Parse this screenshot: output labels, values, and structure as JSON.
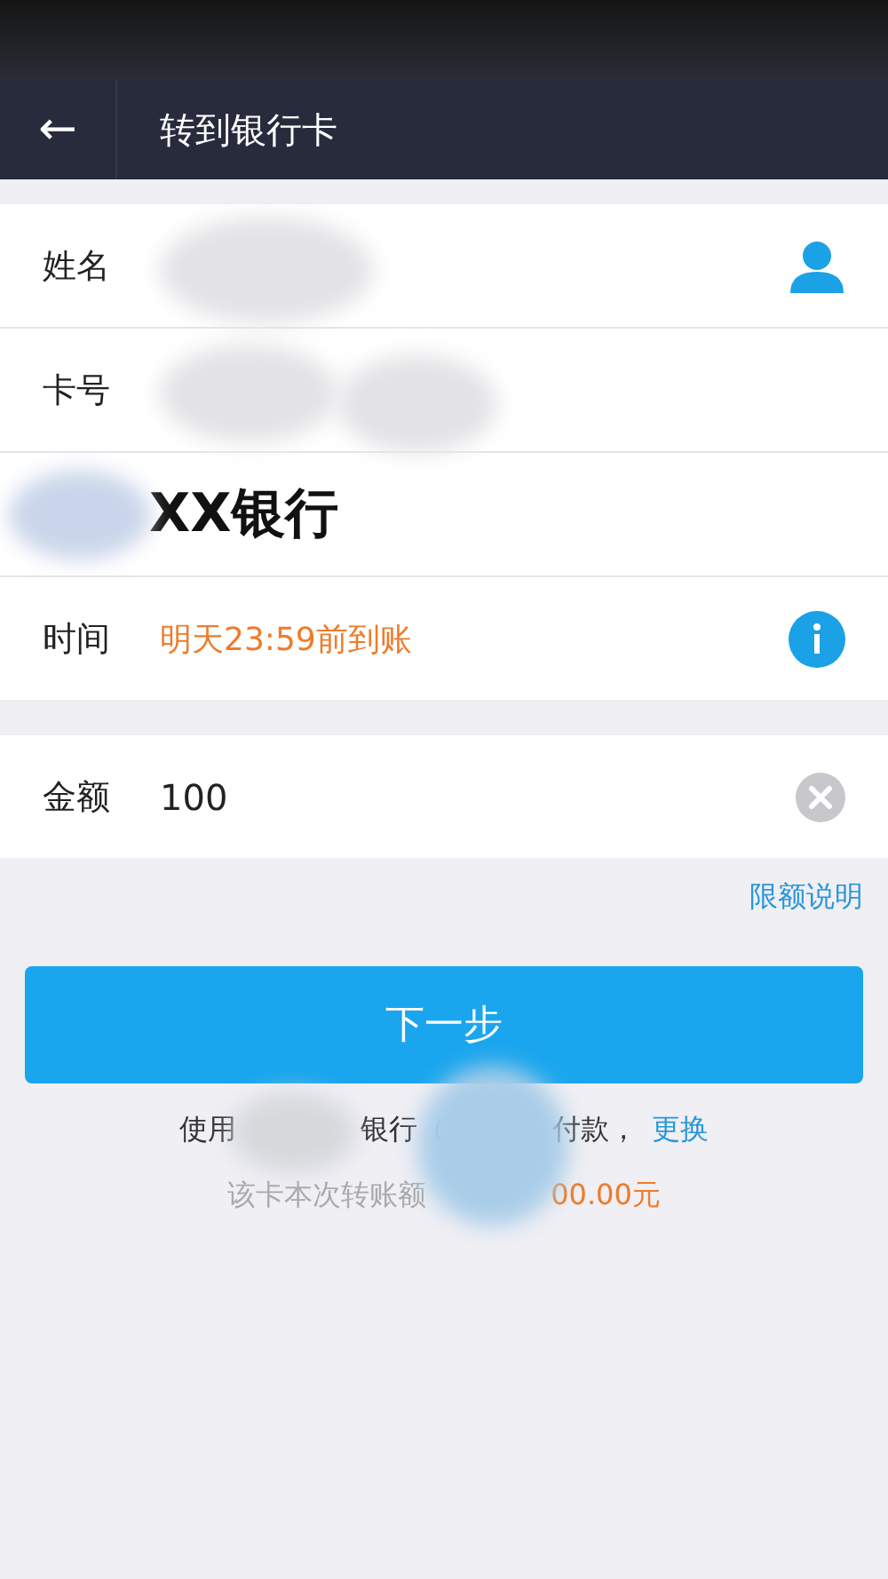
{
  "nav_bar": {
    "back_icon": "←",
    "title": "转到银行卡"
  },
  "recipient": [
    {
      "kind": "name",
      "label": "姓名"
    },
    {
      "kind": "card",
      "label": "卡号"
    },
    {
      "kind": "bank",
      "value": "XX银行"
    },
    {
      "kind": "time",
      "label": "时间",
      "value": "明天23:59前到账"
    }
  ],
  "amount": {
    "label": "金额",
    "value": "100"
  },
  "limit_link": "限额说明",
  "next_button": "下一步",
  "payment_note": {
    "prefix": "使用",
    "bank": "银行（",
    "suffix": "付款，",
    "change_link": "更换"
  },
  "limit_note": {
    "text": "该卡本次转账额",
    "amount": "00.00元"
  }
}
